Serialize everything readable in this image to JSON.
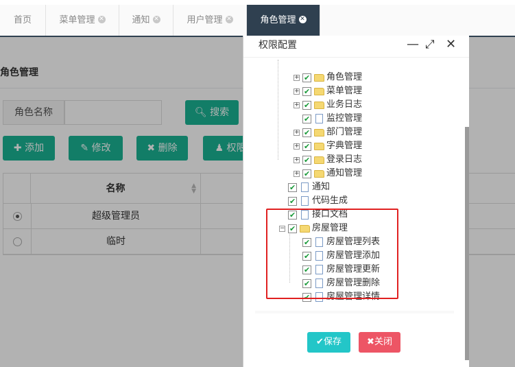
{
  "tabs": [
    {
      "label": "首页",
      "closable": false
    },
    {
      "label": "菜单管理",
      "closable": true
    },
    {
      "label": "通知",
      "closable": true
    },
    {
      "label": "用户管理",
      "closable": true
    },
    {
      "label": "角色管理",
      "closable": true,
      "active": true
    }
  ],
  "page": {
    "title": "角色管理",
    "search_label": "角色名称",
    "search_value": "",
    "search_button": "搜索",
    "toolbar": {
      "add": "添加",
      "edit": "修改",
      "delete": "删除",
      "perm": "权限"
    },
    "table": {
      "header": "名称",
      "rows": [
        {
          "name": "超级管理员",
          "selected": true
        },
        {
          "name": "临时",
          "selected": false
        }
      ]
    }
  },
  "modal": {
    "title": "权限配置",
    "tree": [
      {
        "label": "角色管理",
        "type": "folder",
        "expand": "+"
      },
      {
        "label": "菜单管理",
        "type": "folder",
        "expand": "+"
      },
      {
        "label": "业务日志",
        "type": "folder",
        "expand": "+"
      },
      {
        "label": "监控管理",
        "type": "file"
      },
      {
        "label": "部门管理",
        "type": "folder",
        "expand": "+"
      },
      {
        "label": "字典管理",
        "type": "folder",
        "expand": "+"
      },
      {
        "label": "登录日志",
        "type": "folder",
        "expand": "+"
      },
      {
        "label": "通知管理",
        "type": "folder",
        "expand": "+"
      },
      {
        "label": "通知",
        "type": "file"
      },
      {
        "label": "代码生成",
        "type": "file"
      },
      {
        "label": "接口文档",
        "type": "file"
      },
      {
        "label": "房屋管理",
        "type": "folder",
        "expand": "−"
      },
      {
        "label": "房屋管理列表",
        "type": "file"
      },
      {
        "label": "房屋管理添加",
        "type": "file"
      },
      {
        "label": "房屋管理更新",
        "type": "file"
      },
      {
        "label": "房屋管理删除",
        "type": "file"
      },
      {
        "label": "房屋管理详情",
        "type": "file"
      }
    ],
    "save_label": "保存",
    "close_label": "关闭"
  },
  "colors": {
    "tab_active": "#2f4050",
    "primary_green": "#1ab394",
    "save_button": "#23c6c8",
    "close_button": "#ed5565",
    "highlight_box": "#e02020"
  }
}
